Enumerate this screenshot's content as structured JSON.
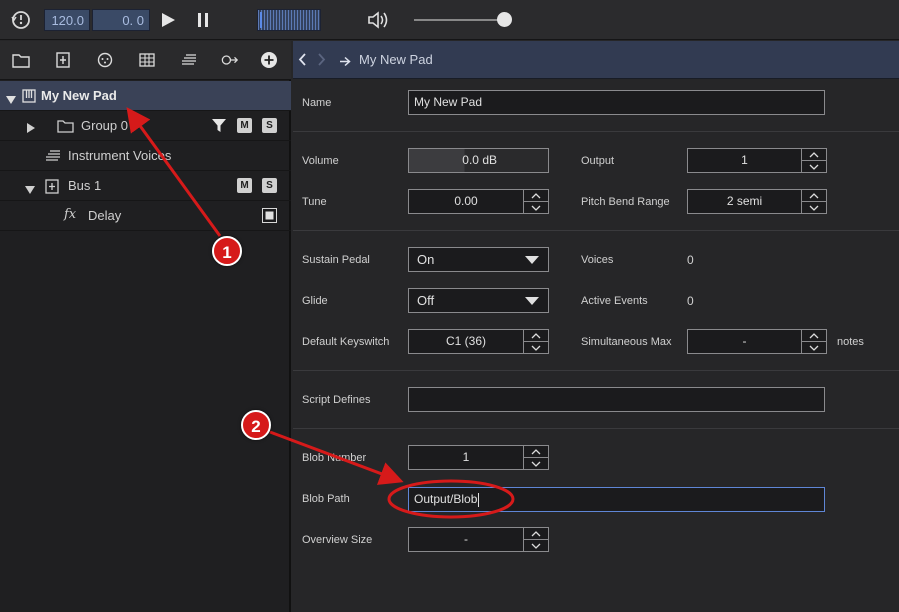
{
  "transport": {
    "tempo": "120.0",
    "position": "0. 0"
  },
  "tree": {
    "items": [
      {
        "label": "My New Pad"
      },
      {
        "label": "Group 0",
        "mute": "M",
        "solo": "S"
      },
      {
        "label": "Instrument Voices"
      },
      {
        "label": "Bus 1",
        "mute": "M",
        "solo": "S"
      },
      {
        "label": "Delay"
      }
    ]
  },
  "breadcrumb": {
    "title": "My New Pad"
  },
  "form": {
    "name_label": "Name",
    "name_value": "My New Pad",
    "volume_label": "Volume",
    "volume_value": "0.0 dB",
    "output_label": "Output",
    "output_value": "1",
    "tune_label": "Tune",
    "tune_value": "0.00",
    "pbr_label": "Pitch Bend Range",
    "pbr_value": "2 semi",
    "sustain_label": "Sustain Pedal",
    "sustain_value": "On",
    "voices_label": "Voices",
    "voices_value": "0",
    "glide_label": "Glide",
    "glide_value": "Off",
    "active_label": "Active Events",
    "active_value": "0",
    "keyswitch_label": "Default Keyswitch",
    "keyswitch_value": "C1 (36)",
    "simmax_label": "Simultaneous Max",
    "simmax_value": "-",
    "simmax_unit": "notes",
    "script_label": "Script Defines",
    "script_value": "",
    "blobnum_label": "Blob Number",
    "blobnum_value": "1",
    "blobpath_label": "Blob Path",
    "blobpath_value": "Output/Blob",
    "overview_label": "Overview Size",
    "overview_value": "-"
  },
  "annotations": {
    "badge1": "1",
    "badge2": "2"
  },
  "colors": {
    "accent": "#5f86d6",
    "selection": "#3a4257",
    "annotation": "#d61a1a"
  },
  "icons": [
    "history-icon",
    "play-icon",
    "pause-icon",
    "volume-icon",
    "folder-icon",
    "add-group-icon",
    "instrument-icon",
    "grid-icon",
    "voices-icon",
    "route-icon",
    "add-icon",
    "back-icon",
    "forward-icon",
    "arrow-right-icon",
    "piano-icon",
    "funnel-icon",
    "fx-icon"
  ]
}
